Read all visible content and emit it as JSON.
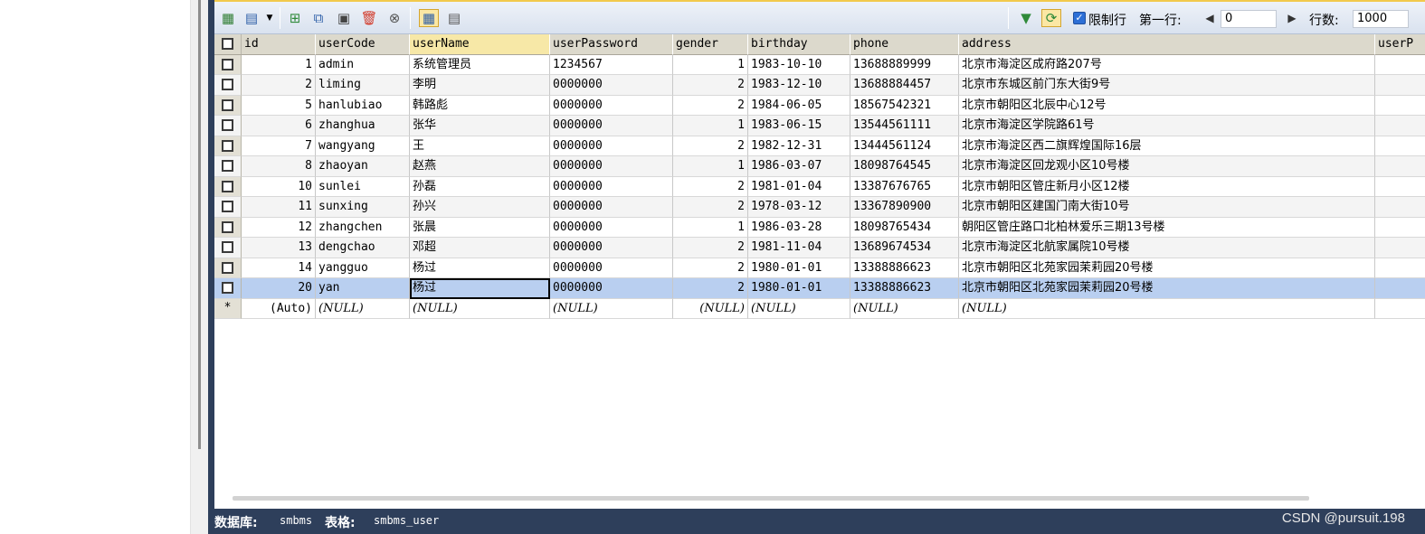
{
  "toolbar": {
    "limit_rows_label": "限制行",
    "first_row_label": "第一行:",
    "first_row_value": "0",
    "rows_label": "行数:",
    "rows_value": "1000"
  },
  "grid": {
    "columns": [
      "id",
      "userCode",
      "userName",
      "userPassword",
      "gender",
      "birthday",
      "phone",
      "address",
      "userP"
    ],
    "rows": [
      {
        "id": "1",
        "userCode": "admin",
        "userName": "系统管理员",
        "userPassword": "1234567",
        "gender": "1",
        "birthday": "1983-10-10",
        "phone": "13688889999",
        "address": "北京市海淀区成府路207号"
      },
      {
        "id": "2",
        "userCode": "liming",
        "userName": "李明",
        "userPassword": "0000000",
        "gender": "2",
        "birthday": "1983-12-10",
        "phone": "13688884457",
        "address": "北京市东城区前门东大街9号"
      },
      {
        "id": "5",
        "userCode": "hanlubiao",
        "userName": "韩路彪",
        "userPassword": "0000000",
        "gender": "2",
        "birthday": "1984-06-05",
        "phone": "18567542321",
        "address": "北京市朝阳区北辰中心12号"
      },
      {
        "id": "6",
        "userCode": "zhanghua",
        "userName": "张华",
        "userPassword": "0000000",
        "gender": "1",
        "birthday": "1983-06-15",
        "phone": "13544561111",
        "address": "北京市海淀区学院路61号"
      },
      {
        "id": "7",
        "userCode": "wangyang",
        "userName": "王",
        "userPassword": "0000000",
        "gender": "2",
        "birthday": "1982-12-31",
        "phone": "13444561124",
        "address": "北京市海淀区西二旗辉煌国际16层"
      },
      {
        "id": "8",
        "userCode": "zhaoyan",
        "userName": "赵燕",
        "userPassword": "0000000",
        "gender": "1",
        "birthday": "1986-03-07",
        "phone": "18098764545",
        "address": "北京市海淀区回龙观小区10号楼"
      },
      {
        "id": "10",
        "userCode": "sunlei",
        "userName": "孙磊",
        "userPassword": "0000000",
        "gender": "2",
        "birthday": "1981-01-04",
        "phone": "13387676765",
        "address": "北京市朝阳区管庄新月小区12楼"
      },
      {
        "id": "11",
        "userCode": "sunxing",
        "userName": "孙兴",
        "userPassword": "0000000",
        "gender": "2",
        "birthday": "1978-03-12",
        "phone": "13367890900",
        "address": "北京市朝阳区建国门南大街10号"
      },
      {
        "id": "12",
        "userCode": "zhangchen",
        "userName": "张晨",
        "userPassword": "0000000",
        "gender": "1",
        "birthday": "1986-03-28",
        "phone": "18098765434",
        "address": "朝阳区管庄路口北柏林爱乐三期13号楼"
      },
      {
        "id": "13",
        "userCode": "dengchao",
        "userName": "邓超",
        "userPassword": "0000000",
        "gender": "2",
        "birthday": "1981-11-04",
        "phone": "13689674534",
        "address": "北京市海淀区北航家属院10号楼"
      },
      {
        "id": "14",
        "userCode": "yangguo",
        "userName": "杨过",
        "userPassword": "0000000",
        "gender": "2",
        "birthday": "1980-01-01",
        "phone": "13388886623",
        "address": "北京市朝阳区北苑家园茉莉园20号楼"
      },
      {
        "id": "20",
        "userCode": "yan",
        "userName": "杨过",
        "userPassword": "0000000",
        "gender": "2",
        "birthday": "1980-01-01",
        "phone": "13388886623",
        "address": "北京市朝阳区北苑家园茉莉园20号楼"
      }
    ],
    "new_row": {
      "marker": "*",
      "id": "(Auto)",
      "null": "(NULL)"
    }
  },
  "status": {
    "database_label": "数据库:",
    "database_value": "smbms",
    "table_label": "表格:",
    "table_value": "smbms_user"
  },
  "watermark": "CSDN @pursuit.198"
}
